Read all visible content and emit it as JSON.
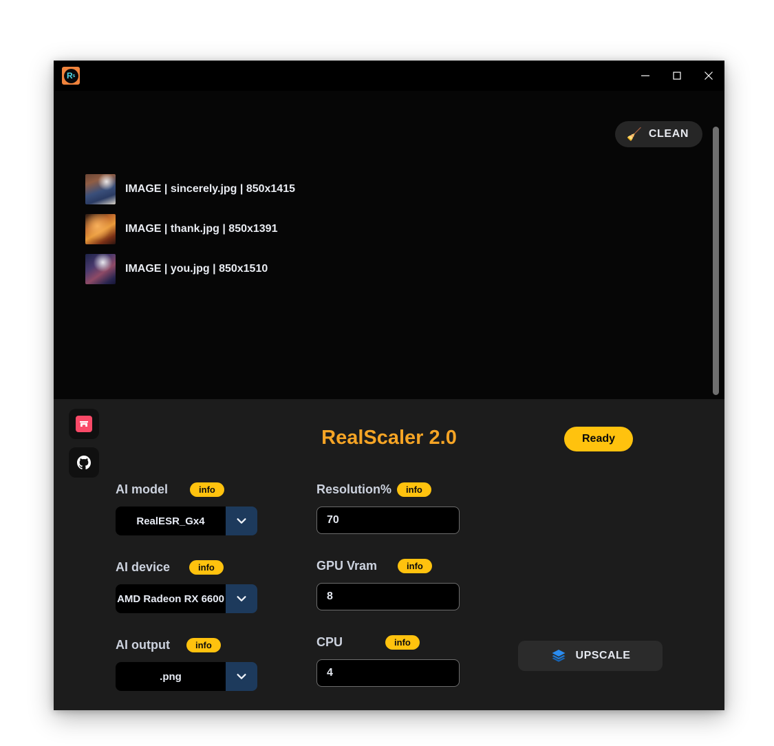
{
  "window": {
    "app_icon_text": "R",
    "app_icon_sub": "s",
    "controls": {
      "minimize": "minimize-icon",
      "maximize": "maximize-icon",
      "close": "close-icon"
    }
  },
  "file_area": {
    "clean_button": {
      "label": "CLEAN",
      "icon": "broom-icon",
      "glyph": "🧹"
    },
    "files": [
      {
        "text": "IMAGE | sincerely.jpg | 850x1415",
        "type": "IMAGE",
        "name": "sincerely.jpg",
        "dimensions": "850x1415"
      },
      {
        "text": "IMAGE | thank.jpg | 850x1391",
        "type": "IMAGE",
        "name": "thank.jpg",
        "dimensions": "850x1391"
      },
      {
        "text": "IMAGE | you.jpg | 850x1510",
        "type": "IMAGE",
        "name": "you.jpg",
        "dimensions": "850x1510"
      }
    ]
  },
  "panel": {
    "title": "RealScaler 2.0",
    "status": "Ready",
    "side_links": [
      {
        "name": "itch-io-link",
        "icon": "itch-io-icon"
      },
      {
        "name": "github-link",
        "icon": "github-icon"
      }
    ],
    "info_label": "info",
    "fields": {
      "ai_model": {
        "label": "AI model",
        "value": "RealESR_Gx4",
        "info": "info"
      },
      "ai_device": {
        "label": "AI device",
        "value": "AMD Radeon RX 6600",
        "info": "info"
      },
      "ai_output": {
        "label": "AI output",
        "value": ".png",
        "info": "info"
      },
      "resolution": {
        "label": "Resolution%",
        "value": "70",
        "info": "info"
      },
      "gpu_vram": {
        "label": "GPU Vram",
        "value": "8",
        "info": "info"
      },
      "cpu": {
        "label": "CPU",
        "value": "4",
        "info": "info"
      }
    },
    "upscale_button": {
      "label": "UPSCALE",
      "icon": "layers-icon"
    }
  },
  "colors": {
    "accent_orange": "#f5a425",
    "accent_yellow": "#ffc20e",
    "dropdown_blue": "#1d3a5c",
    "upscale_icon_blue": "#2b8cf0",
    "itch_pink": "#fa4a68",
    "window_bg": "#1c1c1c",
    "file_area_bg": "#060606"
  }
}
